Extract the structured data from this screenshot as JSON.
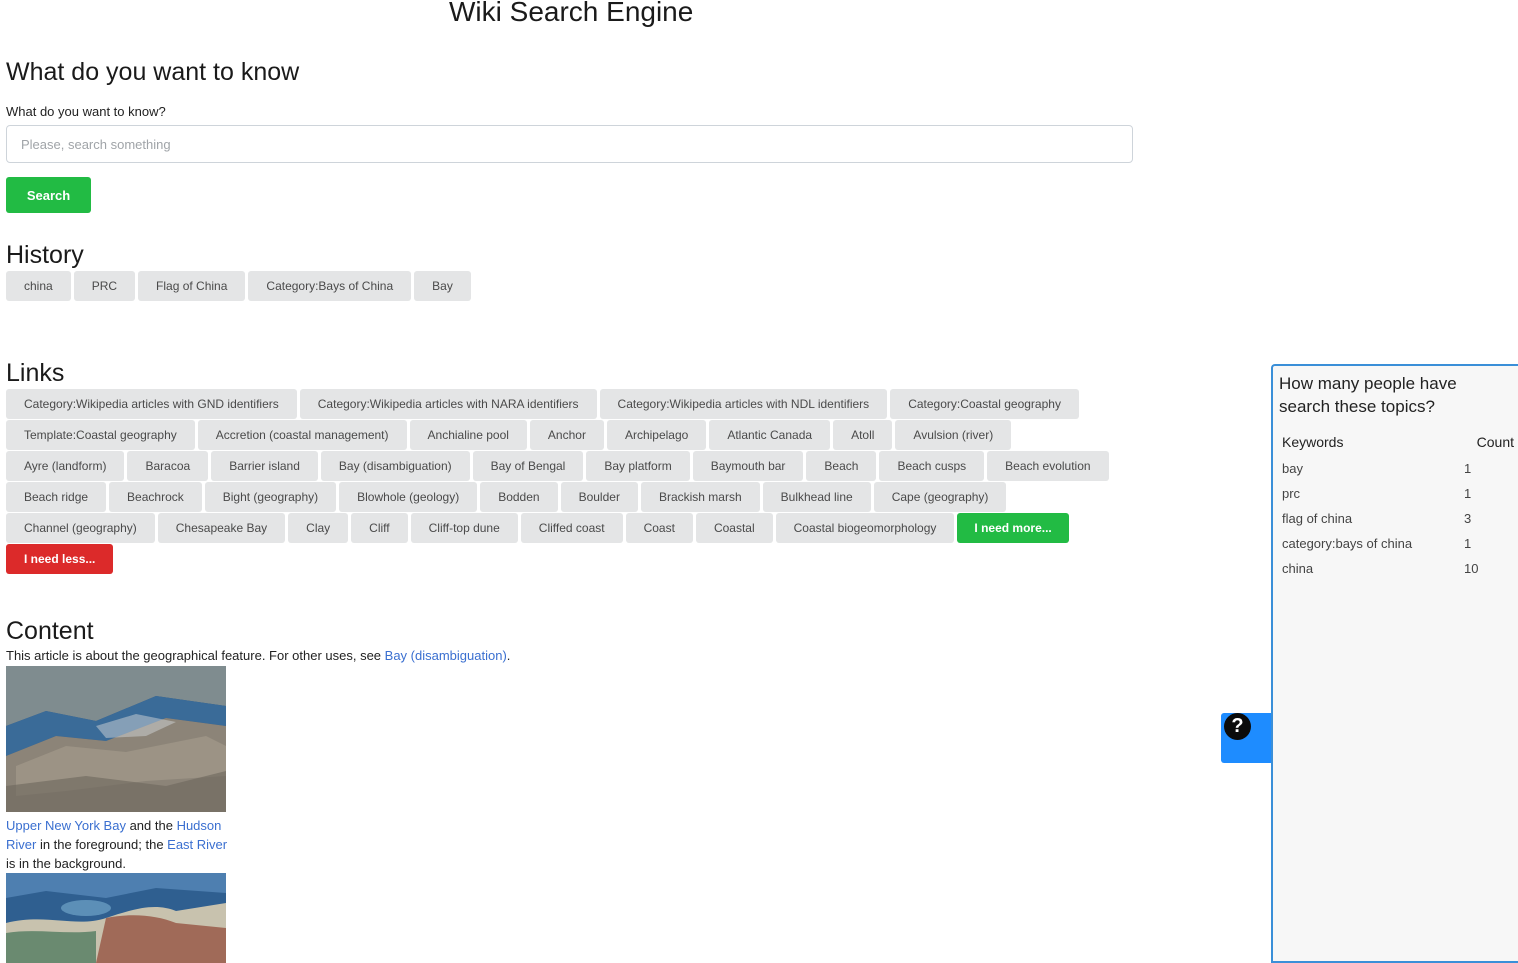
{
  "header": {
    "title": "Wiki Search Engine"
  },
  "search": {
    "heading": "What do you want to know",
    "label": "What do you want to know?",
    "placeholder": "Please, search something",
    "value": "",
    "button_label": "Search",
    "button_color": "#22bb44"
  },
  "history": {
    "heading": "History",
    "items": [
      "china",
      "PRC",
      "Flag of China",
      "Category:Bays of China",
      "Bay"
    ]
  },
  "links": {
    "heading": "Links",
    "items": [
      "Category:Wikipedia articles with GND identifiers",
      "Category:Wikipedia articles with NARA identifiers",
      "Category:Wikipedia articles with NDL identifiers",
      "Category:Coastal geography",
      "Template:Coastal geography",
      "Accretion (coastal management)",
      "Anchialine pool",
      "Anchor",
      "Archipelago",
      "Atlantic Canada",
      "Atoll",
      "Avulsion (river)",
      "Ayre (landform)",
      "Baracoa",
      "Barrier island",
      "Bay (disambiguation)",
      "Bay of Bengal",
      "Bay platform",
      "Baymouth bar",
      "Beach",
      "Beach cusps",
      "Beach evolution",
      "Beach ridge",
      "Beachrock",
      "Bight (geography)",
      "Blowhole (geology)",
      "Bodden",
      "Boulder",
      "Brackish marsh",
      "Bulkhead line",
      "Cape (geography)",
      "Channel (geography)",
      "Chesapeake Bay",
      "Clay",
      "Cliff",
      "Cliff-top dune",
      "Cliffed coast",
      "Coast",
      "Coastal",
      "Coastal biogeomorphology"
    ],
    "more_label": "I need more...",
    "less_label": "I need less...",
    "more_color": "#22bb44",
    "less_color": "#dc2a2a"
  },
  "content": {
    "heading": "Content",
    "intro_text": "This article is about the geographical feature. For other uses, see ",
    "intro_link": "Bay (disambiguation)",
    "intro_end": ".",
    "caption": {
      "link_1": "Upper New York Bay",
      "text_1": " and the ",
      "link_2": "Hudson River",
      "text_2": " in the foreground; the ",
      "link_3": "East River",
      "text_3": " is in the background."
    }
  },
  "help": {
    "icon": "question-circle-icon",
    "glyph": "?",
    "color": "#1e8cff"
  },
  "stats": {
    "title": "How many people have search these topics?",
    "col_keywords": "Keywords",
    "col_count": "Count",
    "rows": [
      {
        "keyword": "bay",
        "count": "1"
      },
      {
        "keyword": "prc",
        "count": "1"
      },
      {
        "keyword": "flag of china",
        "count": "3"
      },
      {
        "keyword": "category:bays of china",
        "count": "1"
      },
      {
        "keyword": "china",
        "count": "10"
      }
    ]
  }
}
